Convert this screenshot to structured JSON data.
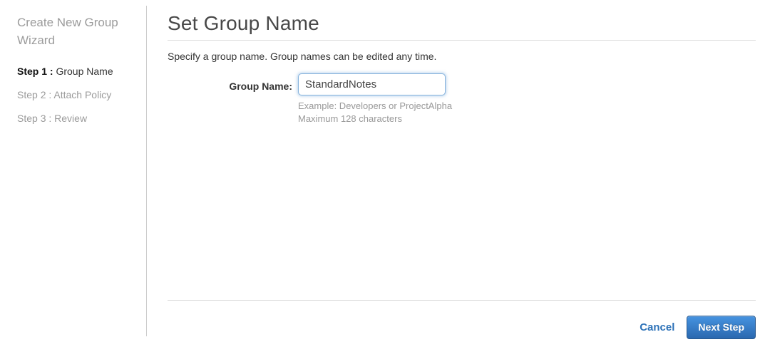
{
  "sidebar": {
    "title": "Create New Group Wizard",
    "steps": [
      {
        "prefix": "Step 1 :",
        "label": " Group Name",
        "active": true
      },
      {
        "prefix": "Step 2 :",
        "label": " Attach Policy",
        "active": false
      },
      {
        "prefix": "Step 3 :",
        "label": " Review",
        "active": false
      }
    ]
  },
  "main": {
    "title": "Set Group Name",
    "description": "Specify a group name. Group names can be edited any time.",
    "form": {
      "label": "Group Name:",
      "value": "StandardNotes",
      "hint_example": "Example: Developers or ProjectAlpha",
      "hint_max": "Maximum 128 characters"
    },
    "footer": {
      "cancel_label": "Cancel",
      "next_label": "Next Step"
    }
  },
  "colors": {
    "link_blue": "#2d72b8",
    "button_gradient_top": "#4693e0",
    "button_gradient_bottom": "#2a68af",
    "input_focus_border": "#85b2dc",
    "divider_gray": "#cccccc",
    "muted_text": "#999999"
  }
}
